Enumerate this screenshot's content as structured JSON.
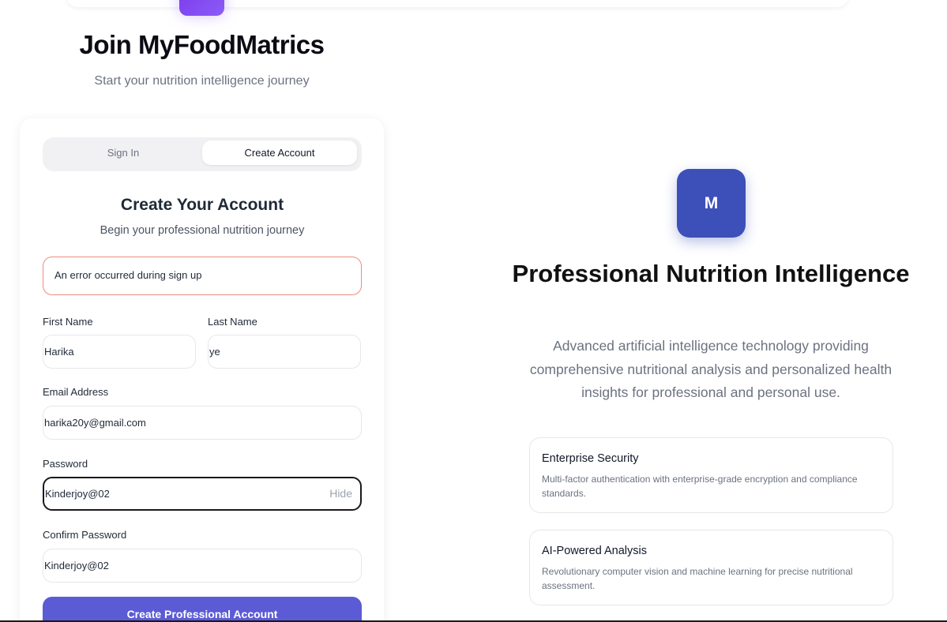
{
  "header": {
    "title": "Join MyFoodMatrics",
    "subtitle": "Start your nutrition intelligence journey"
  },
  "auth_tabs": {
    "sign_in": "Sign In",
    "create_account": "Create Account"
  },
  "form": {
    "title": "Create Your Account",
    "subtitle": "Begin your professional nutrition journey",
    "error_message": "An error occurred during sign up",
    "first_name": {
      "label": "First Name",
      "value": "Harika"
    },
    "last_name": {
      "label": "Last Name",
      "value": "ye"
    },
    "email": {
      "label": "Email Address",
      "value": "harika20y@gmail.com"
    },
    "password": {
      "label": "Password",
      "value": "Kinderjoy@02",
      "toggle_label": "Hide"
    },
    "confirm_password": {
      "label": "Confirm Password",
      "value": "Kinderjoy@02"
    },
    "submit_label": "Create Professional Account"
  },
  "brand": {
    "logo_letter": "M",
    "title": "Professional Nutrition Intelligence",
    "description": "Advanced artificial intelligence technology providing comprehensive nutritional analysis and personalized health insights for professional and personal use."
  },
  "features": [
    {
      "title": "Enterprise Security",
      "description": "Multi-factor authentication with enterprise-grade encryption and compliance standards."
    },
    {
      "title": "AI-Powered Analysis",
      "description": "Revolutionary computer vision and machine learning for precise nutritional assessment."
    }
  ],
  "colors": {
    "primary_button": "#5b5bd6",
    "logo_bg": "#3d4fb8",
    "error_border": "#f08a80",
    "top_logo_accent": "#7c3aed"
  }
}
